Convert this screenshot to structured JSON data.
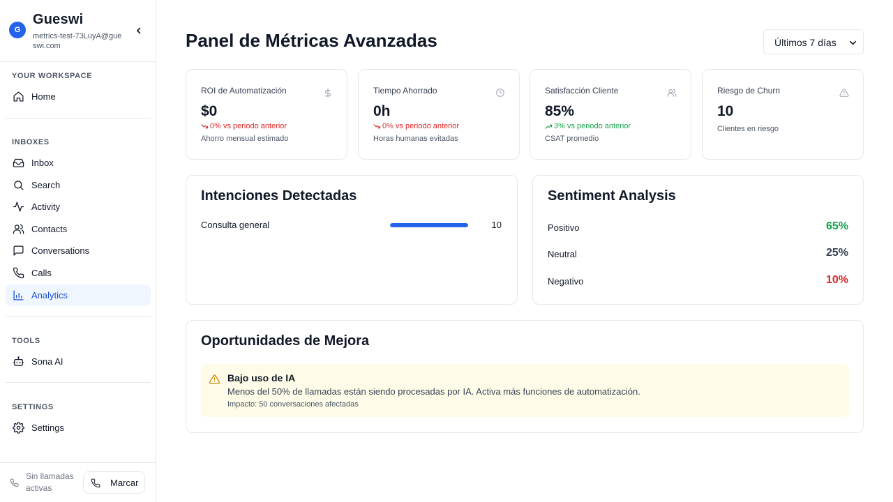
{
  "sidebar": {
    "avatar_initial": "G",
    "brand_name": "Gueswi",
    "account_email": "metrics-test-73LuyA@gueswi.com",
    "sections": {
      "workspace": "YOUR WORKSPACE",
      "inboxes": "INBOXES",
      "tools": "TOOLS",
      "settings": "SETTINGS"
    },
    "items": [
      {
        "label": "Home",
        "icon": "home-icon"
      },
      {
        "label": "Inbox",
        "icon": "inbox-icon"
      },
      {
        "label": "Search",
        "icon": "search-icon"
      },
      {
        "label": "Activity",
        "icon": "activity-icon"
      },
      {
        "label": "Contacts",
        "icon": "users-icon"
      },
      {
        "label": "Conversations",
        "icon": "message-square-icon"
      },
      {
        "label": "Calls",
        "icon": "phone-icon"
      },
      {
        "label": "Analytics",
        "icon": "bar-chart-icon",
        "active": true
      },
      {
        "label": "Sona AI",
        "icon": "bot-icon"
      },
      {
        "label": "Settings",
        "icon": "gear-icon"
      }
    ],
    "footer": {
      "call_status": "Sin llamadas activas",
      "dial_label": "Marcar"
    }
  },
  "header": {
    "title": "Panel de Métricas Avanzadas",
    "range_selected": "Últimos 7 días"
  },
  "kpis": [
    {
      "title": "ROI de Automatización",
      "icon": "dollar-icon",
      "value": "$0",
      "trend": "0% vs periodo anterior",
      "trend_dir": "down",
      "sub": "Ahorro mensual estimado"
    },
    {
      "title": "Tiempo Ahorrado",
      "icon": "clock-icon",
      "value": "0h",
      "trend": "0% vs periodo anterior",
      "trend_dir": "down",
      "sub": "Horas humanas evitadas"
    },
    {
      "title": "Satisfacción Cliente",
      "icon": "users-icon",
      "value": "85%",
      "trend": "3% vs periodo anterior",
      "trend_dir": "up",
      "sub": "CSAT promedio"
    },
    {
      "title": "Riesgo de Churn",
      "icon": "alert-triangle-icon",
      "value": "10",
      "sub": "Clientes en riesgo"
    }
  ],
  "intents": {
    "title": "Intenciones Detectadas",
    "items": [
      {
        "label": "Consulta general",
        "count": "10",
        "fill_fraction": 1.0
      }
    ]
  },
  "sentiment": {
    "title": "Sentiment Analysis",
    "items": [
      {
        "label": "Positivo",
        "value": "65%",
        "color": "#16a34a"
      },
      {
        "label": "Neutral",
        "value": "25%",
        "color": "#374151"
      },
      {
        "label": "Negativo",
        "value": "10%",
        "color": "#dc2626"
      }
    ]
  },
  "opportunities": {
    "title": "Oportunidades de Mejora",
    "alert": {
      "title": "Bajo uso de IA",
      "description": "Menos del 50% de llamadas están siendo procesadas por IA. Activa más funciones de automatización.",
      "impact": "Impacto: 50 conversaciones afectadas"
    }
  },
  "colors": {
    "accent": "#2563eb",
    "positive": "#16a34a",
    "negative": "#dc2626",
    "alert_bg": "#fefce8",
    "alert_icon": "#ca8a04"
  }
}
